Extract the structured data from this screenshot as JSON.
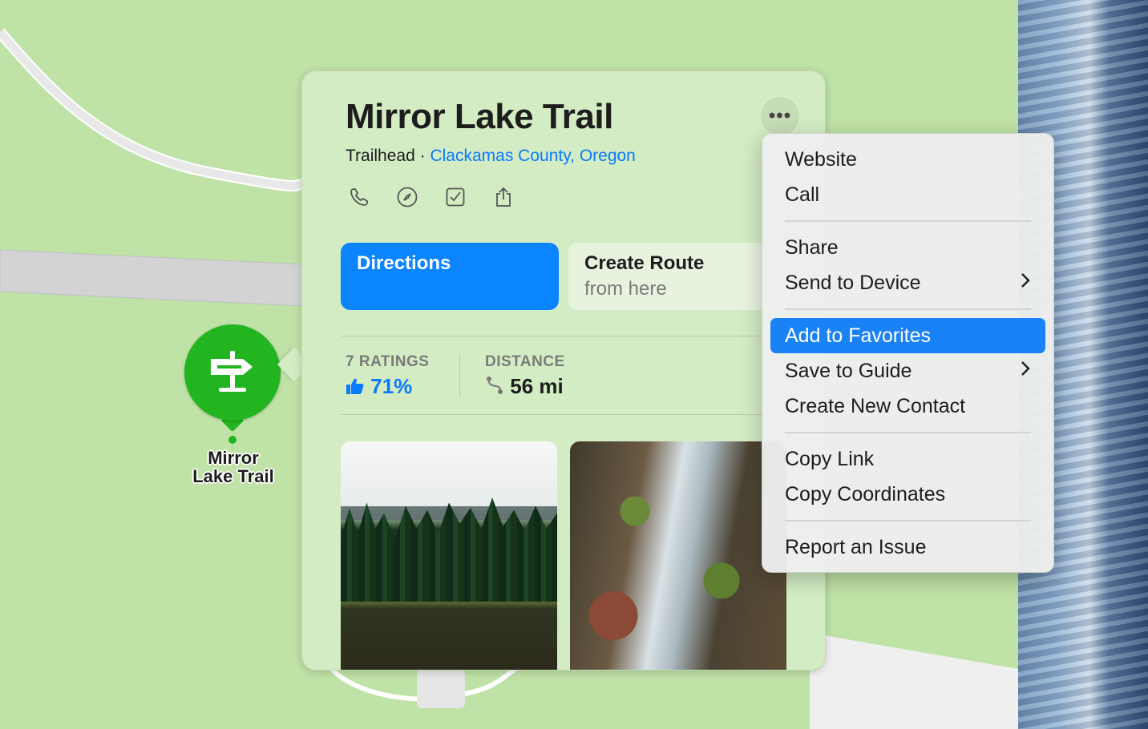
{
  "place": {
    "title": "Mirror Lake Trail",
    "category": "Trailhead",
    "separator": "·",
    "location_link": "Clackamas County, Oregon",
    "more_button": "•••"
  },
  "quick_actions": [
    {
      "name": "phone-icon"
    },
    {
      "name": "compass-icon"
    },
    {
      "name": "checkbox-icon"
    },
    {
      "name": "share-icon"
    }
  ],
  "buttons": {
    "directions": "Directions",
    "create_route_line1": "Create Route",
    "create_route_line2": "from here"
  },
  "stats": {
    "ratings_label": "7 RATINGS",
    "ratings_value": "71%",
    "distance_label": "DISTANCE",
    "distance_value": "56 mi"
  },
  "map_pin": {
    "label_line1": "Mirror",
    "label_line2": "Lake Trail",
    "icon": "trail-sign-icon",
    "color": "#22b51f"
  },
  "context_menu": {
    "items": [
      {
        "label": "Website"
      },
      {
        "label": "Call"
      },
      {
        "label": "Share"
      },
      {
        "label": "Send to Device",
        "submenu": true
      },
      {
        "label": "Add to Favorites",
        "highlighted": true
      },
      {
        "label": "Save to Guide",
        "submenu": true
      },
      {
        "label": "Create New Contact"
      },
      {
        "label": "Copy Link"
      },
      {
        "label": "Copy Coordinates"
      },
      {
        "label": "Report an Issue"
      }
    ],
    "chevron": "›"
  },
  "colors": {
    "accent": "#0a84ff",
    "map_background": "#bfe2a6",
    "card_background": "#d3ecc3",
    "menu_highlight": "#1a82f7"
  }
}
